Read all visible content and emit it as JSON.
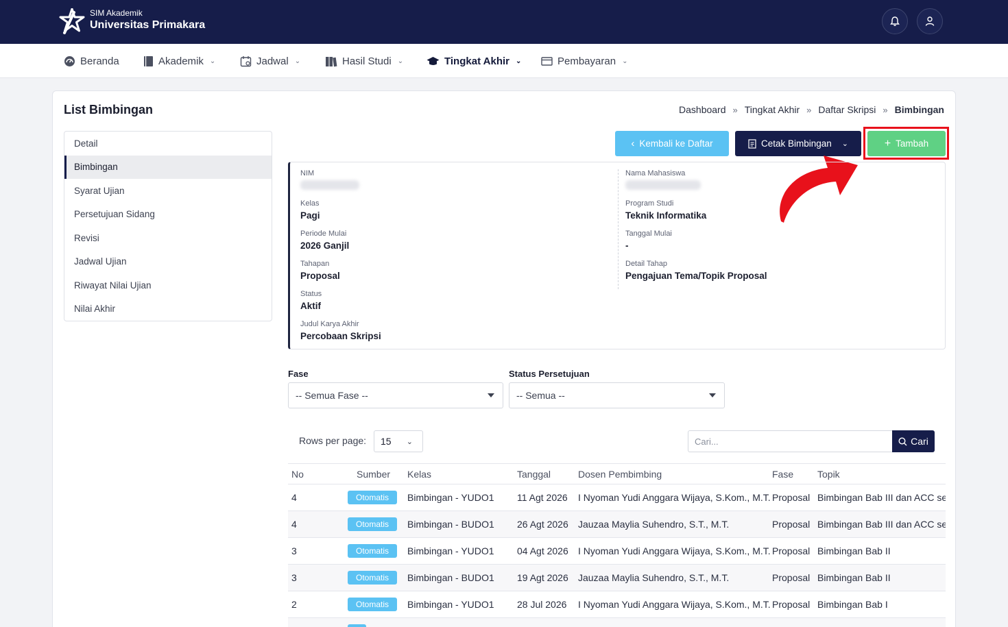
{
  "header": {
    "subtitle": "SIM Akademik",
    "title": "Universitas Primakara",
    "icons": [
      "logo-icon",
      "bell-icon",
      "user-icon"
    ]
  },
  "nav": [
    {
      "label": "Beranda",
      "icon": "dashboard-icon",
      "dropdown": false,
      "active": false
    },
    {
      "label": "Akademik",
      "icon": "book-icon",
      "dropdown": true,
      "active": false
    },
    {
      "label": "Jadwal",
      "icon": "calendar-icon",
      "dropdown": true,
      "active": false
    },
    {
      "label": "Hasil Studi",
      "icon": "books-icon",
      "dropdown": true,
      "active": false
    },
    {
      "label": "Tingkat Akhir",
      "icon": "graduation-cap-icon",
      "dropdown": true,
      "active": true
    },
    {
      "label": "Pembayaran",
      "icon": "wallet-icon",
      "dropdown": true,
      "active": false
    }
  ],
  "page": {
    "title": "List Bimbingan",
    "breadcrumb": [
      "Dashboard",
      "Tingkat Akhir",
      "Daftar Skripsi",
      "Bimbingan"
    ]
  },
  "side_menu": {
    "active": "Bimbingan",
    "items": [
      "Detail",
      "Bimbingan",
      "Syarat Ujian",
      "Persetujuan Sidang",
      "Revisi",
      "Jadwal Ujian",
      "Riwayat Nilai Ujian",
      "Nilai Akhir"
    ]
  },
  "actions": {
    "back_label": "Kembali ke Daftar",
    "print_label": "Cetak Bimbingan",
    "add_label": "Tambah"
  },
  "detail": {
    "nim_label": "NIM",
    "nama_label": "Nama Mahasiswa",
    "kelas_label": "Kelas",
    "kelas": "Pagi",
    "prodi_label": "Program Studi",
    "prodi": "Teknik Informatika",
    "periode_label": "Periode Mulai",
    "periode": "2026 Ganjil",
    "tanggal_label": "Tanggal Mulai",
    "tanggal": "-",
    "tahapan_label": "Tahapan",
    "tahapan": "Proposal",
    "detail_tahap_label": "Detail Tahap",
    "detail_tahap": "Pengajuan Tema/Topik Proposal",
    "status_label": "Status",
    "status": "Aktif",
    "judul_label": "Judul Karya Akhir",
    "judul": "Percobaan Skripsi"
  },
  "filters": {
    "fase_label": "Fase",
    "fase_value": "-- Semua Fase --",
    "status_label": "Status Persetujuan",
    "status_value": "-- Semua --"
  },
  "table_controls": {
    "rows_label": "Rows per page:",
    "rows_value": "15",
    "search_placeholder": "Cari...",
    "search_button": "Cari"
  },
  "table": {
    "columns": [
      "No",
      "Sumber",
      "Kelas",
      "Tanggal",
      "Dosen Pembimbing",
      "Fase",
      "Topik"
    ],
    "rows": [
      {
        "no": "4",
        "sumber": "Otomatis",
        "kelas": "Bimbingan - YUDO1",
        "tanggal": "11 Agt 2026",
        "dosen": "I Nyoman Yudi Anggara Wijaya, S.Kom., M.T.",
        "fase": "Proposal",
        "topik": "Bimbingan Bab III dan ACC se"
      },
      {
        "no": "4",
        "sumber": "Otomatis",
        "kelas": "Bimbingan - BUDO1",
        "tanggal": "26 Agt 2026",
        "dosen": "Jauzaa Maylia Suhendro, S.T., M.T.",
        "fase": "Proposal",
        "topik": "Bimbingan Bab III dan ACC se"
      },
      {
        "no": "3",
        "sumber": "Otomatis",
        "kelas": "Bimbingan - YUDO1",
        "tanggal": "04 Agt 2026",
        "dosen": "I Nyoman Yudi Anggara Wijaya, S.Kom., M.T.",
        "fase": "Proposal",
        "topik": "Bimbingan Bab II"
      },
      {
        "no": "3",
        "sumber": "Otomatis",
        "kelas": "Bimbingan - BUDO1",
        "tanggal": "19 Agt 2026",
        "dosen": "Jauzaa Maylia Suhendro, S.T., M.T.",
        "fase": "Proposal",
        "topik": "Bimbingan Bab II"
      },
      {
        "no": "2",
        "sumber": "Otomatis",
        "kelas": "Bimbingan - YUDO1",
        "tanggal": "28 Jul 2026",
        "dosen": "I Nyoman Yudi Anggara Wijaya, S.Kom., M.T.",
        "fase": "Proposal",
        "topik": "Bimbingan Bab I"
      }
    ]
  },
  "colors": {
    "brand_navy": "#161d4a",
    "info_blue": "#5bc2f3",
    "success_green": "#5fd184",
    "highlight_red": "#e8111b"
  }
}
